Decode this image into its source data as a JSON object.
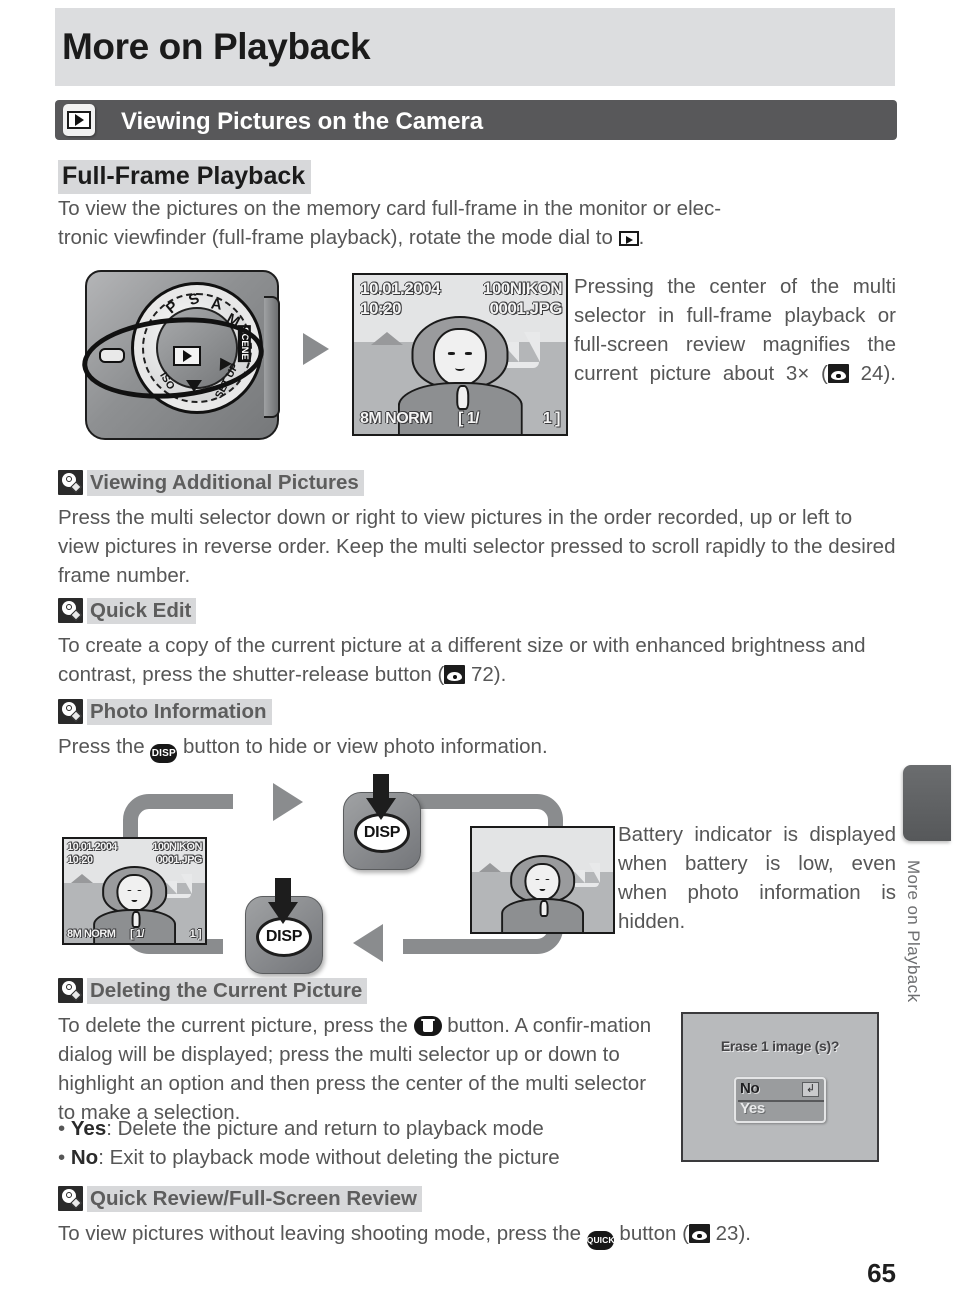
{
  "chapter": {
    "title": "More on Playback"
  },
  "section": {
    "icon": "playback-mode-icon",
    "title": "Viewing Pictures on the Camera"
  },
  "subsection": {
    "title": "Full-Frame Playback"
  },
  "intro": {
    "line1": "To view the pictures on the memory card full-frame in the monitor or elec-",
    "line2_before": "tronic viewfinder (full-frame playback), rotate the mode dial to ",
    "line2_after": "."
  },
  "dial": {
    "labels": [
      "P",
      "S",
      "A",
      "M",
      "SCENE",
      "SET UP",
      "ISO"
    ],
    "scene_label": "SCENE",
    "setup_label": "SET UP",
    "iso_label": "ISO",
    "selected": "playback-icon"
  },
  "lcd_main": {
    "date": "10.01.2004",
    "time": "10:20",
    "folder": "100NIKON",
    "file": "0001.JPG",
    "quality": "8M NORM",
    "frame_left": "[   1/",
    "frame_right": "1 ]"
  },
  "magnify_note": {
    "text": "Pressing the center of the multi selector in full-frame playback or full-screen review magnifies the current picture about 3× (",
    "page_ref": "24",
    "tail": ")."
  },
  "tips": [
    {
      "id": "viewing-additional-pictures",
      "heading": "Viewing Additional Pictures",
      "body": "Press the multi selector down or right to view pictures in the order recorded, up or left to view pictures in reverse order.  Keep the multi selector pressed to scroll rapidly to the desired frame number."
    },
    {
      "id": "quick-edit",
      "heading": "Quick Edit",
      "body_before": "To create a copy of the current picture at a different size or with enhanced brightness and contrast, press the shutter-release button (",
      "page_ref": "72",
      "body_after": ")."
    },
    {
      "id": "photo-information",
      "heading": "Photo Information",
      "body_before": "Press the ",
      "button": "DISP",
      "body_after": " button to hide or view photo information."
    },
    {
      "id": "deleting-the-current-picture",
      "heading": "Deleting the Current Picture",
      "body_before": "To delete the current picture, press the ",
      "button": "trash-button",
      "body_after": " button.  A confir-mation dialog will be displayed; press the multi selector up or down to highlight an option and then press the center of the multi selector to make a selection.",
      "bullets": [
        {
          "term": "Yes",
          "text": ": Delete the picture and return to playback mode"
        },
        {
          "term": "No",
          "text": ": Exit to playback mode without deleting the picture"
        }
      ]
    },
    {
      "id": "quick-review-full-screen-review",
      "heading": "Quick Review/Full-Screen Review",
      "body_before": "To view pictures without leaving shooting mode, press the ",
      "button": "QUICK",
      "body_mid": " button (",
      "page_ref": "23",
      "body_after": ")."
    }
  ],
  "flow": {
    "button_label": "DISP",
    "lcd_left": {
      "date": "10.01.2004",
      "time": "10:20",
      "folder": "100NIKON",
      "file": "0001.JPG",
      "quality": "8M NORM",
      "frame_left": "[   1/",
      "frame_right": "1 ]"
    }
  },
  "battery_note": "Battery indicator is displayed when battery is low, even when photo information is hidden.",
  "erase_dialog": {
    "title": "Erase 1 image (s)?",
    "options": [
      "No",
      "Yes"
    ],
    "selected": "No",
    "enter_glyph": "↲"
  },
  "side_tab": {
    "label": "More on Playback"
  },
  "page_number": "65",
  "colors": {
    "banner": "#dcdddf",
    "section_bar": "#58585a",
    "highlight": "#d7d8da",
    "body_text": "#565656"
  }
}
